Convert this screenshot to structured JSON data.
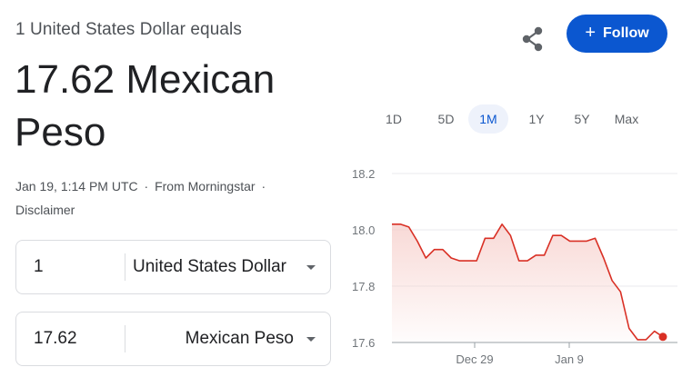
{
  "header": {
    "subtitle": "1 United States Dollar equals",
    "rate_line": "17.62 Mexican Peso",
    "timestamp": "Jan 19, 1:14 PM UTC",
    "separator": "·",
    "source": "From Morningstar",
    "disclaimer": "Disclaimer"
  },
  "actions": {
    "share_icon": "share-icon",
    "follow_plus": "+",
    "follow_label": "Follow"
  },
  "converter": {
    "from": {
      "amount": "1",
      "currency": "United States Dollar"
    },
    "to": {
      "amount": "17.62",
      "currency": "Mexican Peso"
    }
  },
  "time_ranges": [
    "1D",
    "5D",
    "1M",
    "1Y",
    "5Y",
    "Max"
  ],
  "active_range": "1M",
  "colors": {
    "accent": "#0b57d0",
    "line": "#d93025",
    "area_top": "#f6cdc9"
  },
  "chart_data": {
    "type": "area",
    "ylim": [
      17.6,
      18.2
    ],
    "y_ticks": [
      "18.2",
      "18.0",
      "17.8",
      "17.6"
    ],
    "x_tick_labels": [
      "Dec 29",
      "Jan 9"
    ],
    "grid": true,
    "series": [
      {
        "values": [
          18.02,
          18.02,
          18.01,
          17.96,
          17.9,
          17.93,
          17.93,
          17.9,
          17.89,
          17.89,
          17.89,
          17.97,
          17.97,
          18.02,
          17.98,
          17.89,
          17.89,
          17.91,
          17.91,
          17.98,
          17.98,
          17.96,
          17.96,
          17.96,
          17.97,
          17.9,
          17.82,
          17.78,
          17.65,
          17.61,
          17.61,
          17.64,
          17.62
        ]
      }
    ]
  }
}
